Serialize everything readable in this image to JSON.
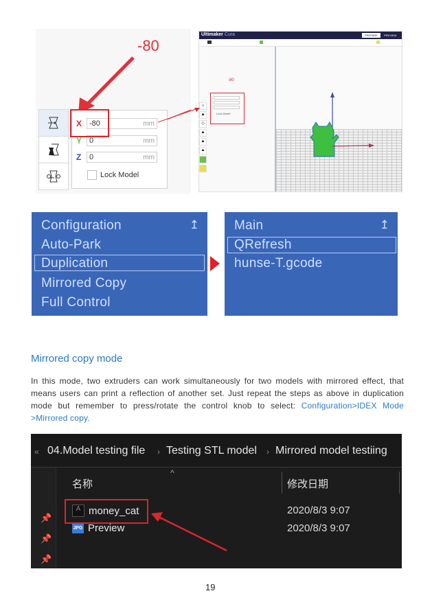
{
  "move_tool": {
    "annotation": "-80",
    "x": {
      "label": "X",
      "value": "-80",
      "unit": "mm"
    },
    "y": {
      "label": "Y",
      "value": "0",
      "unit": "mm"
    },
    "z": {
      "label": "Z",
      "value": "0",
      "unit": "mm"
    },
    "lock_model": "Lock Model",
    "lock_checked": false,
    "tools": [
      "move-icon",
      "scale-icon",
      "rotate-icon"
    ]
  },
  "cura": {
    "brand": "Ultimaker",
    "brand_suffix": "Cura",
    "tab_prepare": "PREPARE",
    "tab_preview": "PREVIEW",
    "annotation": "-80",
    "lock_model": "Lock Model"
  },
  "lcd_left": {
    "items": [
      "Configuration",
      "Auto-Park",
      "Duplication",
      "Mirrored Copy",
      "Full Control"
    ],
    "selected": "Duplication",
    "up_icon": "↥"
  },
  "lcd_right": {
    "items": [
      "Main",
      "QRefresh",
      "hunse-T.gcode"
    ],
    "selected": "QRefresh",
    "up_icon": "↥"
  },
  "section": {
    "title": "Mirrored copy mode",
    "body": "In this mode, two extruders can work simultaneously for two models with mirrored effect, that means users can print a reflection of another set. Just repeat the  steps as above in duplication mode but remember to press/rotate the control knob to select: ",
    "link": "Configuration>IDEX Mode >Mirrored copy",
    "end": "."
  },
  "explorer": {
    "back": "«",
    "breadcrumb": [
      "04.Model testing file",
      "Testing STL model",
      "Mirrored model testiing"
    ],
    "columns": {
      "name": "名称",
      "modified": "修改日期"
    },
    "files": [
      {
        "name": "money_cat",
        "icon": "stl-file-icon",
        "modified": "2020/8/3 9:07"
      },
      {
        "name": "Preview",
        "icon": "jpg-file-icon",
        "modified": "2020/8/3 9:07"
      }
    ]
  },
  "page_number": "19"
}
